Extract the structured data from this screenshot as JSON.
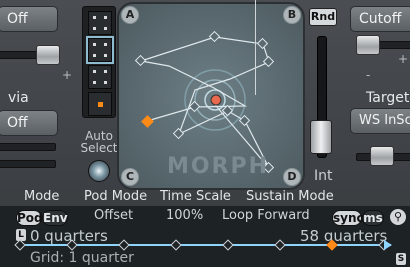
{
  "left_column": {
    "top_field": "Off",
    "via_label": "via",
    "mid_field": "Off"
  },
  "pod": {
    "cells": [
      "pod-1",
      "pod-2",
      "pod-3",
      "pod-4"
    ]
  },
  "auto_select": {
    "label": "Auto Select"
  },
  "pad": {
    "corners": [
      "A",
      "B",
      "C",
      "D"
    ],
    "logo": "MORPH"
  },
  "int": {
    "rnd_label": "Rnd",
    "label": "Int",
    "value": 0.3
  },
  "right_column": {
    "cutoff_field": "Cutoff",
    "target_label": "Target",
    "target_field": "WS InSc"
  },
  "bottom_labels": {
    "mode": "Mode",
    "pod_mode": "Pod Mode",
    "time_scale": "Time Scale",
    "sustain_mode": "Sustain Mode"
  },
  "env": {
    "pod_btn": "Pod",
    "env_btn": "Env",
    "offset": "Offset",
    "time_scale": "100%",
    "sustain": "Loop Forward",
    "sync_btn": "sync",
    "ms_btn": "ms",
    "search_icon": "search-icon",
    "start_label": "0 quarters",
    "end_label": "58 quarters",
    "grid_label": "Grid: 1 quarter",
    "loop_marker": "L",
    "sustain_marker": "S"
  },
  "colors": {
    "accent_orange": "#ff8a18",
    "env_line": "#8fd4ff",
    "pad_bg": "#5f7077"
  }
}
